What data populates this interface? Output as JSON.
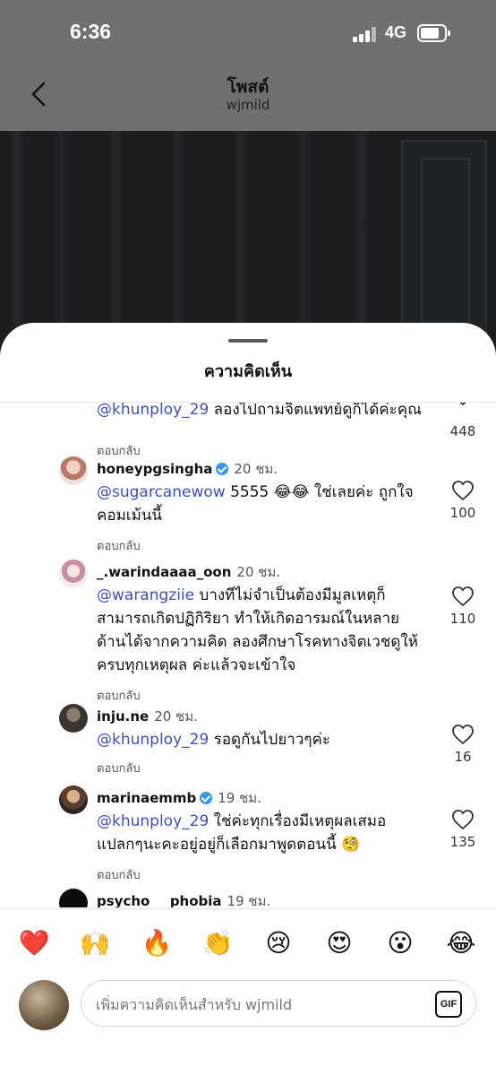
{
  "status_bar": {
    "time": "6:36",
    "network": "4G"
  },
  "nav": {
    "title": "โพสต์",
    "subtitle": "wjmild"
  },
  "sheet": {
    "title": "ความคิดเห็น"
  },
  "comments": [
    {
      "text_mention": "@khunploy_29",
      "text": " ลองไปถามจิตแพทย์ดูก็ได้ค่ะคุณ",
      "reply": "ตอบกลับ",
      "likes": "448"
    },
    {
      "username": "honeypgsingha",
      "verified": true,
      "time": "20 ชม.",
      "text_mention": "@sugarcanewow",
      "text": " 5555 😂😂 ใช่เลยค่ะ ถูกใจคอมเม้นนี้",
      "reply": "ตอบกลับ",
      "likes": "100"
    },
    {
      "username": "_.warindaaaa_oon",
      "verified": false,
      "time": "20 ชม.",
      "text_mention": "@warangziie",
      "text": " บางทีไม่จำเป็นต้องมีมูลเหตุก็สามารถเกิดปฏิกิริยา ทำให้เกิดอารมณ์ในหลายด้านได้จากความคิด ลองศึกษาโรคทางจิตเวชดูให้ครบทุกเหตุผล ค่ะแล้วจะเข้าใจ",
      "reply": "ตอบกลับ",
      "likes": "110"
    },
    {
      "username": "inju.ne",
      "verified": false,
      "time": "20 ชม.",
      "text_mention": "@khunploy_29",
      "text": " รอดูกันไปยาวๆค่ะ",
      "reply": "ตอบกลับ",
      "likes": "16"
    },
    {
      "username": "marinaemmb",
      "verified": true,
      "time": "19 ชม.",
      "text_mention": "@khunploy_29",
      "text": " ใช่ค่ะทุกเรื่องมีเหตุผลเสมอ แปลกๆนะคะอยู่อยู่ก็เลือกมาพูดตอนนี้ 🧐",
      "reply": "ตอบกลับ",
      "likes": "135"
    },
    {
      "username": "psycho___phobia",
      "verified": false,
      "time": "19 ชม."
    }
  ],
  "reactions": [
    "❤️",
    "🙌",
    "🔥",
    "👏",
    "😢",
    "😍",
    "😮",
    "😂"
  ],
  "input": {
    "placeholder": "เพิ่มความคิดเห็นสำหรับ wjmild",
    "gif_label": "GIF"
  },
  "colors": {
    "mention": "#3b4fcd",
    "verified": "#3897f0",
    "dim_overlay": "#6f7071"
  },
  "icons": {
    "back": "chevron-left-icon",
    "like": "heart-outline-icon"
  }
}
